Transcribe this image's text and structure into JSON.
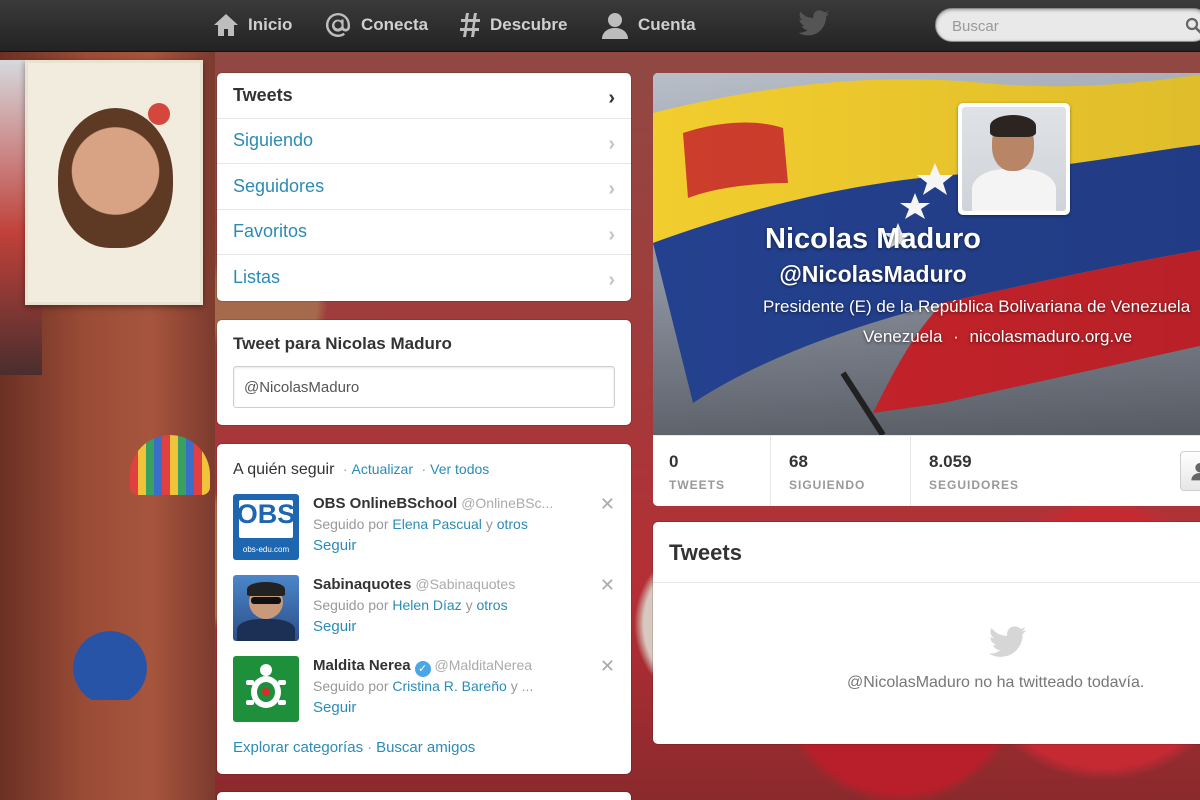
{
  "topbar": {
    "nav": [
      {
        "label": "Inicio",
        "icon": "home-icon"
      },
      {
        "label": "Conecta",
        "icon": "at-icon"
      },
      {
        "label": "Descubre",
        "icon": "hash-icon"
      },
      {
        "label": "Cuenta",
        "icon": "user-icon"
      }
    ],
    "search_placeholder": "Buscar"
  },
  "sidebar": {
    "nav_items": [
      {
        "label": "Tweets"
      },
      {
        "label": "Siguiendo"
      },
      {
        "label": "Seguidores"
      },
      {
        "label": "Favoritos"
      },
      {
        "label": "Listas"
      }
    ],
    "compose": {
      "title": "Tweet para Nicolas Maduro",
      "value": "@NicolasMaduro"
    },
    "who_to_follow": {
      "title": "A quién seguir",
      "refresh": "Actualizar",
      "view_all": "Ver todos",
      "items": [
        {
          "name": "OBS OnlineBSchool",
          "handle": "@OnlineBSc...",
          "followed_prefix": "Seguido por",
          "followed_by": "Elena Pascual",
          "and": "y",
          "others": "otros",
          "follow": "Seguir",
          "avatar_text": "OBS",
          "avatar_subtext": "obs-edu.com"
        },
        {
          "name": "Sabinaquotes",
          "handle": "@Sabinaquotes",
          "followed_prefix": "Seguido por",
          "followed_by": "Helen Díaz",
          "and": "y",
          "others": "otros",
          "follow": "Seguir"
        },
        {
          "name": "Maldita Nerea",
          "handle": "@MalditaNerea",
          "followed_prefix": "Seguido por",
          "followed_by": "Cristina R. Bareño",
          "and": "y ...",
          "others": "",
          "follow": "Seguir"
        }
      ],
      "footer_explore": "Explorar categorías",
      "footer_find": "Buscar amigos"
    }
  },
  "profile": {
    "name": "Nicolas Maduro",
    "handle": "@NicolasMaduro",
    "bio": "Presidente (E) de la República Bolivariana de Venezuela",
    "location": "Venezuela",
    "separator": "·",
    "url": "nicolasmaduro.org.ve",
    "stats": [
      {
        "value": "0",
        "label": "TWEETS"
      },
      {
        "value": "68",
        "label": "SIGUIENDO"
      },
      {
        "value": "8.059",
        "label": "SEGUIDORES"
      }
    ]
  },
  "tweets": {
    "title": "Tweets",
    "empty_message": "@NicolasMaduro no ha twitteado todavía."
  },
  "colors": {
    "link": "#2a8bb8",
    "topbar": "#2b2b2b",
    "flag_yellow": "#f2cd2e",
    "flag_blue": "#24418f",
    "flag_red": "#c8232b"
  }
}
